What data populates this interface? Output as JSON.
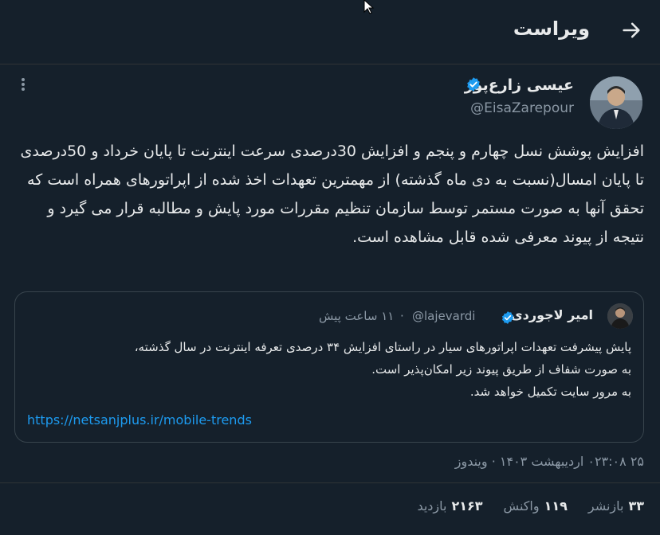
{
  "header": {
    "title": "ویراست",
    "back_icon": "arrow-right-icon"
  },
  "tweet": {
    "author_name": "عیسی زارع‌پور",
    "author_handle": "@EisaZarepour",
    "verified_color": "#1d9bf0",
    "text": "افزایش پوشش نسل چهارم و پنجم و افزایش 30درصدی سرعت اینترنت تا پایان خرداد و 50درصدی تا پایان امسال(نسبت به دی ماه گذشته) از مهمترین تعهدات اخذ شده از اپراتورهای همراه است که تحقق آنها به صورت مستمر توسط سازمان تنظیم مقررات مورد پایش و مطالبه قرار می گیرد و نتیجه از پیوند معرفی شده قابل مشاهده است."
  },
  "quote": {
    "author_name": "امیر لاجوردی",
    "author_handle": "@lajevardi",
    "separator": "·",
    "time": "۱۱ ساعت پیش",
    "text_lines": [
      "پایش پیشرفت تعهدات اپراتورهای سیار در راستای افزایش ۳۴ درصدی تعرفه اینترنت در سال گذشته،",
      "به صورت شفاف از طریق پیوند زیر امکان‌پذیر است.",
      "به مرور سایت تکمیل خواهد شد."
    ],
    "link": "https://netsanjplus.ir/mobile-trends"
  },
  "meta": {
    "line": "۲۵ ۰۲۳:۰۸ اردیبهشت ۱۴۰۳ · ویندوز"
  },
  "stats": {
    "reposts_num": "۳۳",
    "reposts_label": "بازنشر",
    "reactions_num": "۱۱۹",
    "reactions_label": "واکنش",
    "views_num": "۲۱۶۳",
    "views_label": "بازدید"
  },
  "colors": {
    "background": "#15202b",
    "text": "#e7e9ea",
    "muted": "#8b98a5",
    "link": "#1d9bf0",
    "border": "#38444d"
  }
}
